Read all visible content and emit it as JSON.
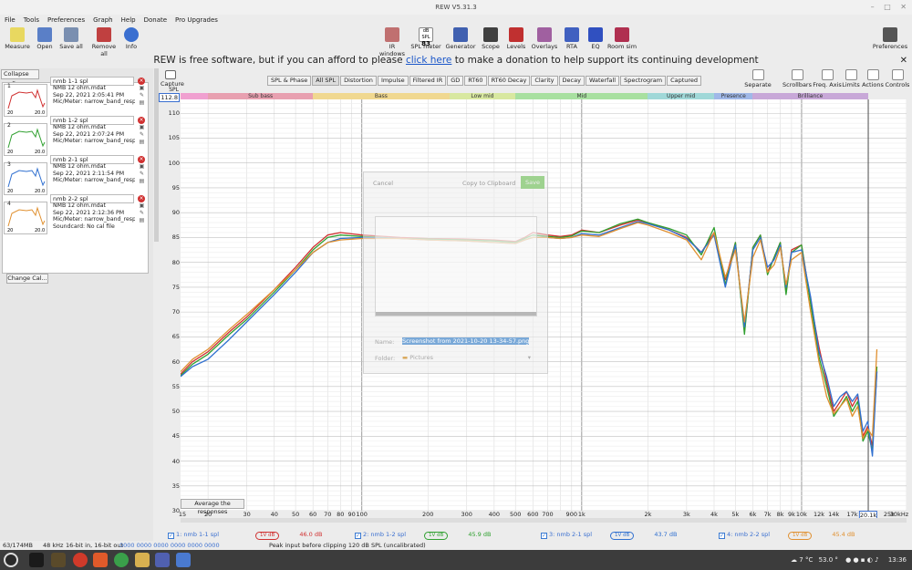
{
  "window": {
    "title": "REW V5.31.3",
    "controls": [
      "–",
      "□",
      "✕"
    ]
  },
  "menu": [
    "File",
    "Tools",
    "Preferences",
    "Graph",
    "Help",
    "Donate",
    "Pro Upgrades"
  ],
  "toolbar": {
    "left": [
      {
        "label": "Measure",
        "icon": "microphone-icon",
        "color": "#e8d860"
      },
      {
        "label": "Open",
        "icon": "folder-open-icon",
        "color": "#5a7fc7"
      },
      {
        "label": "Save all",
        "icon": "save-icon",
        "color": "#7a8fb0"
      },
      {
        "label": "Remove all",
        "icon": "remove-icon",
        "color": "#c04040"
      },
      {
        "label": "Info",
        "icon": "info-icon",
        "color": "#3a6fd0"
      }
    ],
    "right": [
      {
        "label": "IR windows",
        "icon": "ir-windows-icon",
        "color": "#c07070"
      },
      {
        "label": "SPL meter",
        "icon": "spl-meter-icon",
        "color": "#303030",
        "value": "83"
      },
      {
        "label": "Generator",
        "icon": "generator-icon",
        "color": "#4060b0"
      },
      {
        "label": "Scope",
        "icon": "scope-icon",
        "color": "#404040"
      },
      {
        "label": "Levels",
        "icon": "levels-icon",
        "color": "#c03030"
      },
      {
        "label": "Overlays",
        "icon": "overlays-icon",
        "color": "#a060a0"
      },
      {
        "label": "RTA",
        "icon": "rta-icon",
        "color": "#4060c0"
      },
      {
        "label": "EQ",
        "icon": "eq-icon",
        "color": "#3050c0"
      },
      {
        "label": "Room sim",
        "icon": "room-sim-icon",
        "color": "#b03050"
      }
    ],
    "preferences": "Preferences",
    "spl_badge": "dB SPL"
  },
  "donate": {
    "before": "REW is free software, but if you can afford to please ",
    "link": "click here",
    "after": " to make a donation to help support its continuing development",
    "close": "✕"
  },
  "sidebar": {
    "collapse": "Collapse",
    "collapse_icon": "«",
    "change_cal": "Change Cal...",
    "measurements": [
      {
        "num": "1",
        "name": "nmb 1-1 spl",
        "file": "NMB 12 ohm.mdat",
        "date": "Sep 22, 2021 2:05:41 PM",
        "mic": "Mic/Meter: narrow_band_respo",
        "thumb_color": "#d03030",
        "thumb_min": "20",
        "thumb_max": "20.0"
      },
      {
        "num": "2",
        "name": "nmb 1-2 spl",
        "file": "NMB 12 ohm.mdat",
        "date": "Sep 22, 2021 2:07:24 PM",
        "mic": "Mic/Meter: narrow_band_respo",
        "thumb_color": "#30a030",
        "thumb_min": "20",
        "thumb_max": "20.0"
      },
      {
        "num": "3",
        "name": "nmb 2-1 spl",
        "file": "NMB 12 ohm.mdat",
        "date": "Sep 22, 2021 2:11:54 PM",
        "mic": "Mic/Meter: narrow_band_respo",
        "thumb_color": "#3070d0",
        "thumb_min": "20",
        "thumb_max": "20.0"
      },
      {
        "num": "4",
        "name": "nmb 2-2 spl",
        "file": "NMB 12 ohm.mdat",
        "date": "Sep 22, 2021 2:12:36 PM",
        "mic": "Mic/Meter: narrow_band_respo",
        "extra": "Soundcard: No cal file",
        "thumb_color": "#e09030",
        "thumb_min": "20",
        "thumb_max": "20.0"
      }
    ]
  },
  "graph_tabs": [
    "SPL & Phase",
    "All SPL",
    "Distortion",
    "Impulse",
    "Filtered IR",
    "GD",
    "RT60",
    "RT60 Decay",
    "Clarity",
    "Decay",
    "Waterfall",
    "Spectrogram",
    "Captured"
  ],
  "selected_tab": "All SPL",
  "capture": "Capture",
  "graph_tools": [
    "Separate",
    "Scrollbars",
    "Freq. Axis",
    "Limits",
    "Actions",
    "Controls"
  ],
  "bands": [
    {
      "name": "",
      "from": 15,
      "to": 20,
      "color": "#f0a0d0"
    },
    {
      "name": "Sub bass",
      "from": 20,
      "to": 60,
      "color": "#e8a0b0"
    },
    {
      "name": "Bass",
      "from": 60,
      "to": 250,
      "color": "#f0d890"
    },
    {
      "name": "Low mid",
      "from": 250,
      "to": 500,
      "color": "#d8e8a0"
    },
    {
      "name": "Mid",
      "from": 500,
      "to": 2000,
      "color": "#a8e0a0"
    },
    {
      "name": "Upper mid",
      "from": 2000,
      "to": 4000,
      "color": "#a0d8d8"
    },
    {
      "name": "Presence",
      "from": 4000,
      "to": 6000,
      "color": "#a0b8e8"
    },
    {
      "name": "Brilliance",
      "from": 6000,
      "to": 20000,
      "color": "#c8a8d8"
    }
  ],
  "chart_data": {
    "type": "line",
    "ylabel": "SPL",
    "ylim": [
      30,
      112.8
    ],
    "y_top_readout": "112.8",
    "xscale": "log",
    "xlim": [
      15,
      30000
    ],
    "cursor_label": "20.1k",
    "x_ticks": [
      "15",
      "20",
      "30",
      "40",
      "50",
      "60",
      "70",
      "80",
      "90",
      "100",
      "200",
      "300",
      "400",
      "500",
      "600",
      "700",
      "900",
      "1k",
      "2k",
      "3k",
      "4k",
      "5k",
      "6k",
      "7k",
      "8k",
      "9k",
      "10k",
      "12k",
      "14k",
      "17k",
      "20.1k",
      "25k",
      "30kHz"
    ],
    "x_tick_values": [
      15,
      20,
      30,
      40,
      50,
      60,
      70,
      80,
      90,
      100,
      200,
      300,
      400,
      500,
      600,
      700,
      900,
      1000,
      2000,
      3000,
      4000,
      5000,
      6000,
      7000,
      8000,
      9000,
      10000,
      12000,
      14000,
      17000,
      20100,
      25000,
      30000
    ],
    "y_ticks": [
      110,
      105,
      100,
      95,
      90,
      85,
      80,
      75,
      70,
      65,
      60,
      55,
      50,
      45,
      40,
      35,
      30
    ],
    "grid": true,
    "series": [
      {
        "name": "1: nmb 1-1 spl",
        "color": "#d03030",
        "offset_label": "46.0 dB",
        "x": [
          15,
          17,
          20,
          25,
          30,
          40,
          50,
          60,
          70,
          80,
          100,
          150,
          200,
          300,
          400,
          500,
          550,
          600,
          700,
          800,
          900,
          1000,
          1200,
          1500,
          1800,
          2000,
          2500,
          3000,
          3500,
          4000,
          4500,
          5000,
          5500,
          6000,
          6500,
          7000,
          7500,
          8000,
          8500,
          9000,
          10000,
          11000,
          12000,
          13000,
          14000,
          15000,
          16000,
          17000,
          18000,
          19000,
          20000,
          21000,
          22000
        ],
        "y": [
          57.5,
          60,
          62,
          66,
          69,
          74.5,
          79,
          83,
          85.5,
          86,
          85.5,
          85,
          84.8,
          84.7,
          84.5,
          84.2,
          85,
          86,
          85.5,
          85.2,
          85.5,
          86.5,
          86,
          87.5,
          88.5,
          88,
          86.5,
          85,
          82,
          86,
          76.5,
          84,
          66,
          83,
          85.5,
          78,
          81,
          84,
          74,
          82.5,
          83.5,
          72,
          63,
          56,
          50,
          52,
          54,
          51,
          53,
          45,
          47,
          43,
          58
        ]
      },
      {
        "name": "2: nmb 1-2 spl",
        "color": "#30a030",
        "offset_label": "45.9 dB",
        "x": [
          15,
          17,
          20,
          25,
          30,
          40,
          50,
          60,
          70,
          80,
          100,
          150,
          200,
          300,
          400,
          500,
          550,
          600,
          700,
          800,
          900,
          1000,
          1200,
          1500,
          1800,
          2000,
          2500,
          3000,
          3500,
          4000,
          4500,
          5000,
          5500,
          6000,
          6500,
          7000,
          7500,
          8000,
          8500,
          9000,
          10000,
          11000,
          12000,
          13000,
          14000,
          15000,
          16000,
          17000,
          18000,
          19000,
          20000,
          21000,
          22000
        ],
        "y": [
          57.2,
          59.5,
          61.5,
          65.5,
          68.5,
          74,
          78.5,
          82.5,
          85,
          85.5,
          85.2,
          84.8,
          84.7,
          84.5,
          84.3,
          84,
          84.8,
          85.5,
          85.2,
          85,
          85.3,
          86.3,
          86,
          87.8,
          88.7,
          88,
          86.8,
          85.5,
          81.5,
          87,
          75.5,
          84,
          65.5,
          83,
          85.5,
          77.5,
          81,
          84,
          73.5,
          82,
          83.5,
          71.5,
          61,
          55,
          49,
          51,
          53,
          50,
          52,
          44,
          46,
          42,
          59
        ]
      },
      {
        "name": "3: nmb 2-1 spl",
        "color": "#3070d0",
        "offset_label": "43.7 dB",
        "x": [
          15,
          17,
          20,
          25,
          30,
          40,
          50,
          60,
          70,
          80,
          100,
          150,
          200,
          300,
          400,
          500,
          550,
          600,
          700,
          800,
          900,
          1000,
          1200,
          1500,
          1800,
          2000,
          2500,
          3000,
          3500,
          4000,
          4500,
          5000,
          5500,
          6000,
          6500,
          7000,
          7500,
          8000,
          8500,
          9000,
          10000,
          11000,
          12000,
          13000,
          14000,
          15000,
          16000,
          17000,
          18000,
          19000,
          20000,
          21000,
          22000
        ],
        "y": [
          57,
          59,
          60.5,
          64.5,
          68,
          73.5,
          78,
          82,
          84,
          84.8,
          85,
          84.8,
          84.5,
          84.3,
          84,
          83.8,
          84.5,
          85,
          85,
          84.8,
          85,
          85.8,
          85.5,
          87,
          88.2,
          87.8,
          86.5,
          84.8,
          82,
          85.5,
          75,
          83.5,
          67,
          82.5,
          85,
          79,
          80.5,
          83.5,
          75,
          82,
          82.5,
          73,
          62,
          57,
          51,
          53,
          54,
          52,
          53.5,
          46,
          48,
          41,
          58
        ]
      },
      {
        "name": "4: nmb 2-2 spl",
        "color": "#e09030",
        "offset_label": "45.4 dB",
        "x": [
          15,
          17,
          20,
          25,
          30,
          40,
          50,
          60,
          70,
          80,
          100,
          150,
          200,
          300,
          400,
          500,
          550,
          600,
          700,
          800,
          900,
          1000,
          1200,
          1500,
          1800,
          2000,
          2500,
          3000,
          3500,
          4000,
          4500,
          5000,
          5500,
          6000,
          6500,
          7000,
          7500,
          8000,
          8500,
          9000,
          10000,
          11000,
          12000,
          13000,
          14000,
          15000,
          16000,
          17000,
          18000,
          19000,
          20000,
          21000,
          22000
        ],
        "y": [
          58,
          60.5,
          62.5,
          66.5,
          69.5,
          74.5,
          78.5,
          82,
          84,
          84.5,
          84.8,
          84.8,
          84.5,
          84.3,
          84,
          83.8,
          84.5,
          85,
          85,
          84.8,
          85,
          85.5,
          85.2,
          86.8,
          88,
          87.5,
          86,
          84.5,
          80.5,
          86,
          77,
          82.5,
          68,
          81,
          84.5,
          78,
          79.5,
          83,
          75.5,
          80.5,
          82,
          70,
          60,
          53,
          49.5,
          51,
          52.5,
          49,
          51,
          44.5,
          46.5,
          45,
          62.5
        ]
      }
    ]
  },
  "avg_button": "Average the responses",
  "dialog": {
    "cancel": "Cancel",
    "copy": "Copy to Clipboard",
    "save": "Save",
    "name_label": "Name:",
    "name_value": "Screenshot from 2021-10-20 13-34-57.png",
    "folder_label": "Folder:",
    "folder_value": "Pictures"
  },
  "legend_extras": {
    "badge": "1V dB"
  },
  "status": {
    "memory": "63/174MB",
    "rate": "48 kHz",
    "bits": "16-bit in, 16-bit out",
    "counter": "0000 0000 0000 0000 0000 0000",
    "message": "Peak input before clipping 120 dB SPL (uncalibrated)"
  },
  "tray": {
    "temp": "7 °C",
    "value": "53.0 °",
    "time": "13:36"
  }
}
